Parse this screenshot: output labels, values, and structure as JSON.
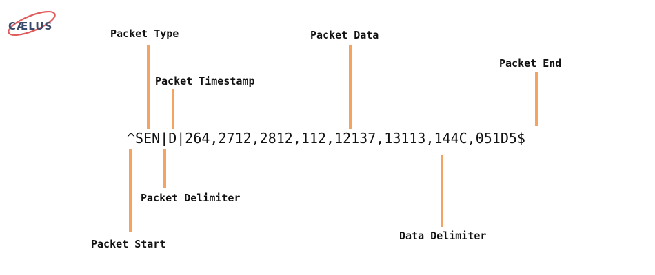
{
  "logo": {
    "text": "CAELUS",
    "ring_color": "#e05a5a",
    "text_color": "#3a4a6b"
  },
  "packet_string": "^SEN|D|264,2712,2812,112,12137,13113,144C,051D5$",
  "labels": {
    "packet_type": "Packet Type",
    "packet_timestamp": "Packet Timestamp",
    "packet_data": "Packet Data",
    "packet_end": "Packet End",
    "packet_delimiter": "Packet Delimiter",
    "packet_start": "Packet Start",
    "data_delimiter": "Data Delimiter"
  },
  "colors": {
    "connector": "#f4a460",
    "text": "#111111",
    "background": "#ffffff"
  }
}
